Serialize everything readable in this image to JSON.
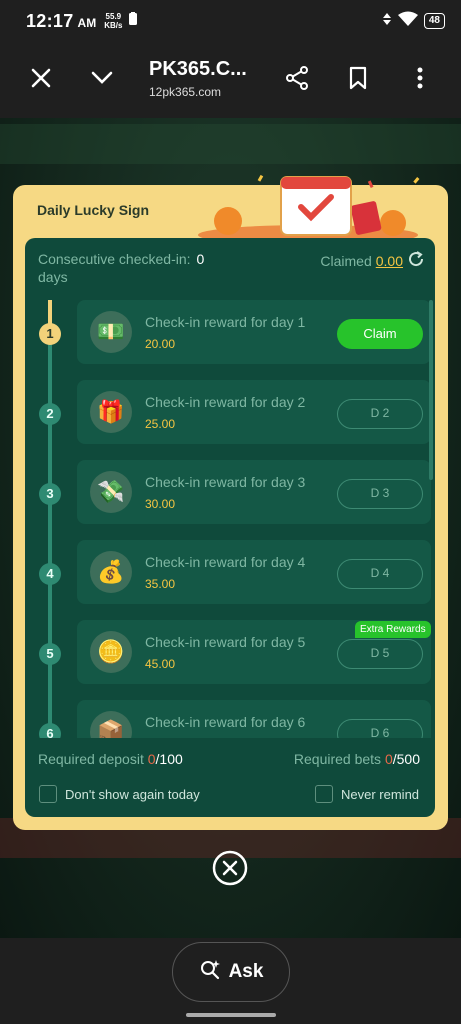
{
  "status_bar": {
    "time": "12:17",
    "ampm": "AM",
    "speed_value": "55.9",
    "speed_unit": "KB/s",
    "battery": "48"
  },
  "browser": {
    "title": "PK365.C...",
    "url": "12pk365.com"
  },
  "modal": {
    "title": "Daily Lucky Sign",
    "consecutive_label": "Consecutive checked-in:",
    "consecutive_value": "0",
    "consecutive_unit": "days",
    "claimed_label": "Claimed",
    "claimed_value": "0.00",
    "rewards": [
      {
        "step": "1",
        "label": "Check-in reward for day 1",
        "amount": "20.00",
        "button": "Claim",
        "icon": "money-stack-icon"
      },
      {
        "step": "2",
        "label": "Check-in reward for day 2",
        "amount": "25.00",
        "button": "D 2",
        "icon": "gift-box-icon"
      },
      {
        "step": "3",
        "label": "Check-in reward for day 3",
        "amount": "30.00",
        "button": "D 3",
        "icon": "cash-pile-icon"
      },
      {
        "step": "4",
        "label": "Check-in reward for day 4",
        "amount": "35.00",
        "button": "D 4",
        "icon": "treasure-icon"
      },
      {
        "step": "5",
        "label": "Check-in reward for day 5",
        "amount": "45.00",
        "button": "D 5",
        "icon": "gold-coins-icon",
        "badge": "Extra Rewards"
      },
      {
        "step": "6",
        "label": "Check-in reward for day 6",
        "amount": "",
        "button": "D 6",
        "icon": "chest-icon"
      }
    ],
    "required_deposit_label": "Required deposit",
    "required_deposit_current": "0",
    "required_deposit_total": "/100",
    "required_bets_label": "Required bets",
    "required_bets_current": "0",
    "required_bets_total": "/500",
    "dont_show_today": "Don't show again today",
    "never_remind": "Never remind"
  },
  "bottom": {
    "ask_label": "Ask"
  },
  "colors": {
    "accent_green": "#27c32b",
    "panel": "#0f4a3b",
    "frame": "#f6d984",
    "gold": "#f5c542"
  }
}
